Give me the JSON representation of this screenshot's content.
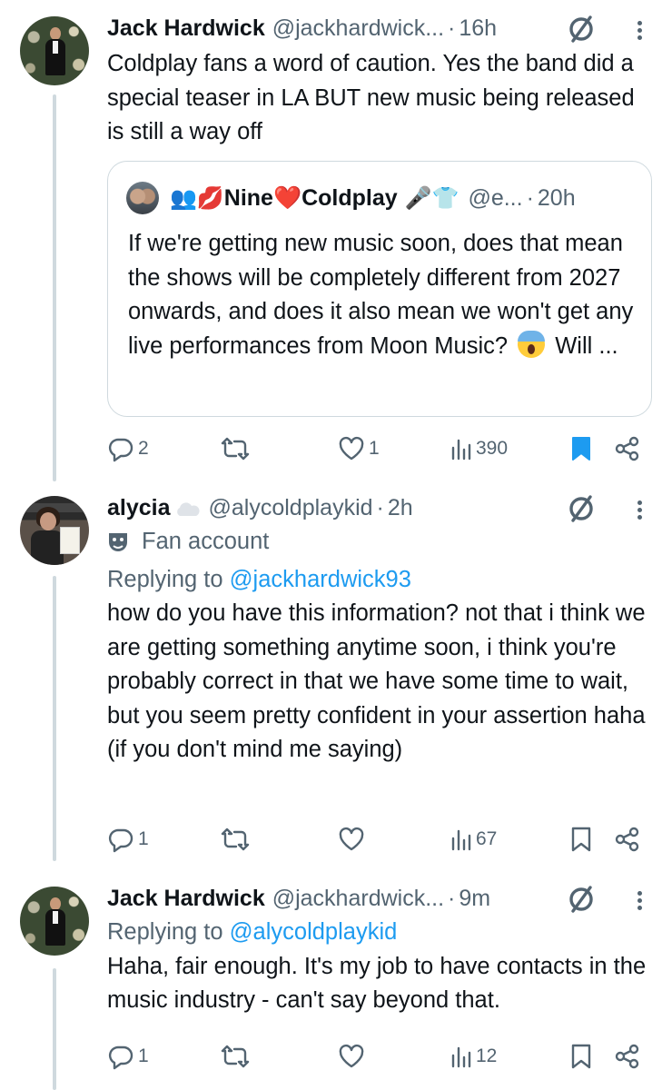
{
  "colors": {
    "accent": "#1d9bf0",
    "secondary_text": "#536471",
    "primary_text": "#0f1419",
    "thread_line": "#cfd9de"
  },
  "tweets": [
    {
      "name": "Jack Hardwick",
      "handle": "@jackhardwick...",
      "separator": "·",
      "time": "16h",
      "text": "Coldplay fans a word of caution. Yes the band did a special teaser in LA BUT new music being released is still a way off",
      "quote": {
        "name": "Nine❤️Coldplay",
        "handle": "@e...",
        "separator": "·",
        "time": "20h",
        "text_before_emoji": "If we're getting new music soon, does that mean the shows will be completely different from 2027 onwards, and does it also mean we won't get any live performances from Moon Music? ",
        "text_after_emoji": " Will ..."
      },
      "actions": {
        "replies": "2",
        "reposts": "",
        "likes": "1",
        "views": "390"
      },
      "bookmarked": true
    },
    {
      "name": "alycia",
      "handle": "@alycoldplaykid",
      "separator": "·",
      "time": "2h",
      "label": "Fan account",
      "replying_prefix": "Replying to ",
      "replying_to": "@jackhardwick93",
      "text": "how do you have this information? not that i think we are getting something anytime soon, i think you're probably correct in that we have some time to wait, but you seem pretty confident in your assertion haha (if you don't mind me saying)",
      "actions": {
        "replies": "1",
        "reposts": "",
        "likes": "",
        "views": "67"
      },
      "bookmarked": false
    },
    {
      "name": "Jack Hardwick",
      "handle": "@jackhardwick...",
      "separator": "·",
      "time": "9m",
      "replying_prefix": "Replying to ",
      "replying_to": "@alycoldplaykid",
      "text": "Haha, fair enough. It's my job to have contacts in the music industry - can't say beyond that.",
      "actions": {
        "replies": "1",
        "reposts": "",
        "likes": "",
        "views": "12"
      },
      "bookmarked": false
    }
  ]
}
